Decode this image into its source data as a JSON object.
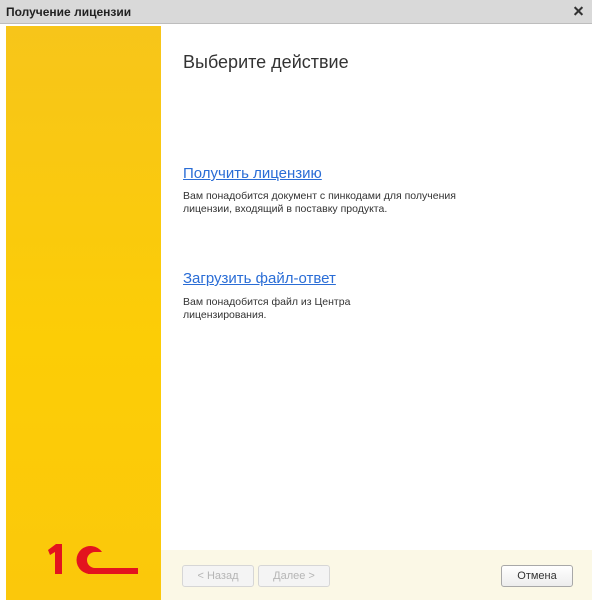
{
  "window": {
    "title": "Получение лицензии"
  },
  "main": {
    "heading": "Выберите действие",
    "options": [
      {
        "link": "Получить лицензию",
        "description_lines": [
          "Вам понадобится документ с пинкодами для получения",
          "лицензии, входящий в поставку продукта."
        ]
      },
      {
        "link": "Загрузить файл-ответ",
        "description_lines": [
          "Вам понадобится файл из Центра",
          "лицензирования."
        ]
      }
    ]
  },
  "buttons": {
    "back": "< Назад",
    "next": "Далее >",
    "cancel": "Отмена"
  },
  "branding": {
    "logo_text": "1С",
    "sidebar_color": "#fcc908",
    "logo_color": "#e3131e",
    "link_color": "#2a6dd6"
  }
}
